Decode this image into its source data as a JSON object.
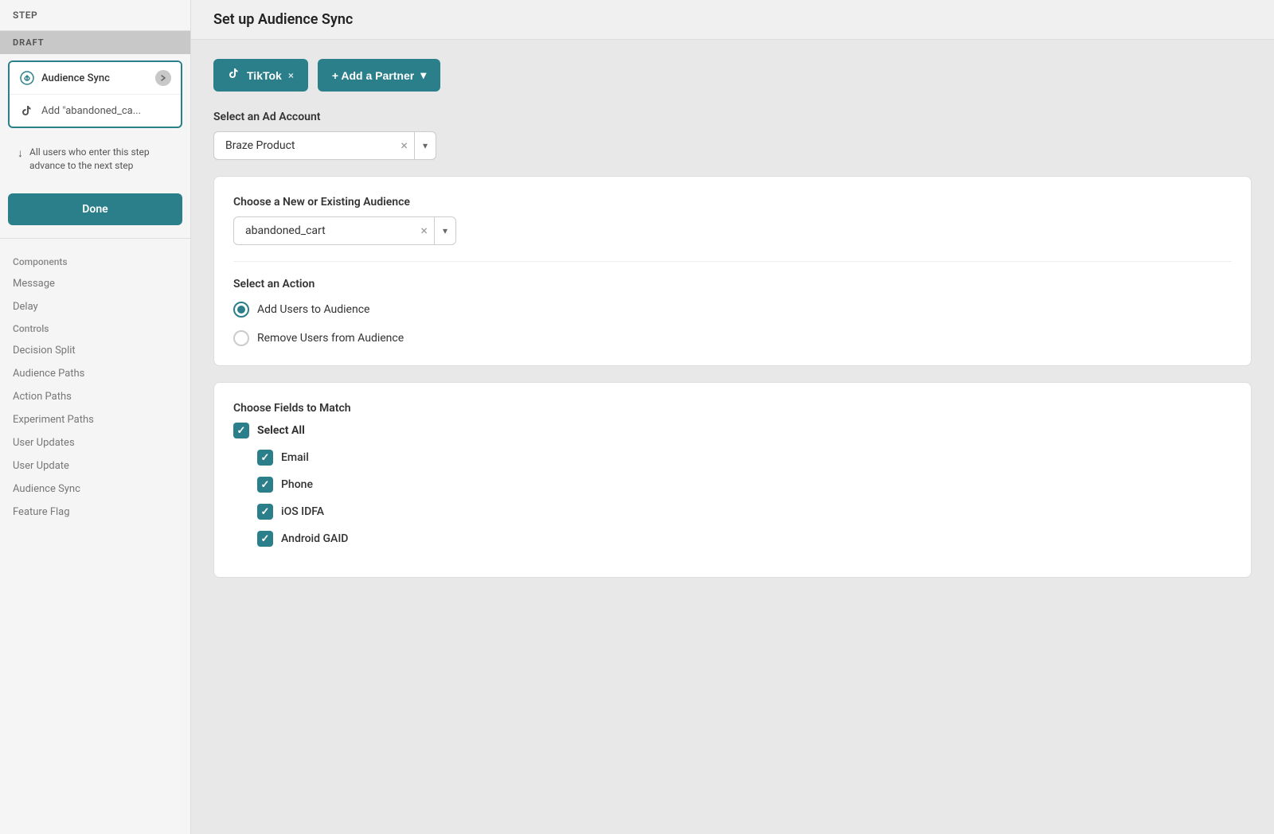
{
  "sidebar": {
    "step_label": "Step",
    "draft_badge": "DRAFT",
    "selected_item_1": {
      "icon": "audience-sync-icon",
      "label": "Audience Sync"
    },
    "selected_item_2": {
      "icon": "tiktok-icon",
      "label": "Add \"abandoned_ca..."
    },
    "info_text": "All users who enter this step advance to the next step",
    "done_button": "Done",
    "nav_items": [
      {
        "section": "Components",
        "label": "Components"
      },
      {
        "label": "Message"
      },
      {
        "label": "Delay"
      },
      {
        "section": "Controls",
        "label": "Controls"
      },
      {
        "label": "Decision Split"
      },
      {
        "label": "Audience Paths"
      },
      {
        "label": "Action Paths"
      },
      {
        "label": "Experiment Paths"
      },
      {
        "label": "User Updates"
      },
      {
        "label": "User Update"
      },
      {
        "label": "Audience Sync"
      },
      {
        "label": "Feature Flag"
      }
    ]
  },
  "main": {
    "header_title": "Set up Audience Sync",
    "tiktok_button_label": "TikTok",
    "tiktok_close": "×",
    "add_partner_label": "+ Add a Partner",
    "ad_account_label": "Select an Ad Account",
    "ad_account_value": "Braze Product",
    "audience_label": "Choose a New or Existing Audience",
    "audience_value": "abandoned_cart",
    "action_label": "Select an Action",
    "action_option_1": "Add Users to Audience",
    "action_option_2": "Remove Users from Audience",
    "fields_label": "Choose Fields to Match",
    "select_all_label": "Select All",
    "field_email": "Email",
    "field_phone": "Phone",
    "field_ios": "iOS IDFA",
    "field_android": "Android GAID"
  },
  "icons": {
    "audience_sync": "⟳",
    "tiktok": "♪",
    "info_arrow": "↓",
    "chevron_right": "›",
    "plus": "+",
    "chevron_down": "▾",
    "close": "×"
  }
}
